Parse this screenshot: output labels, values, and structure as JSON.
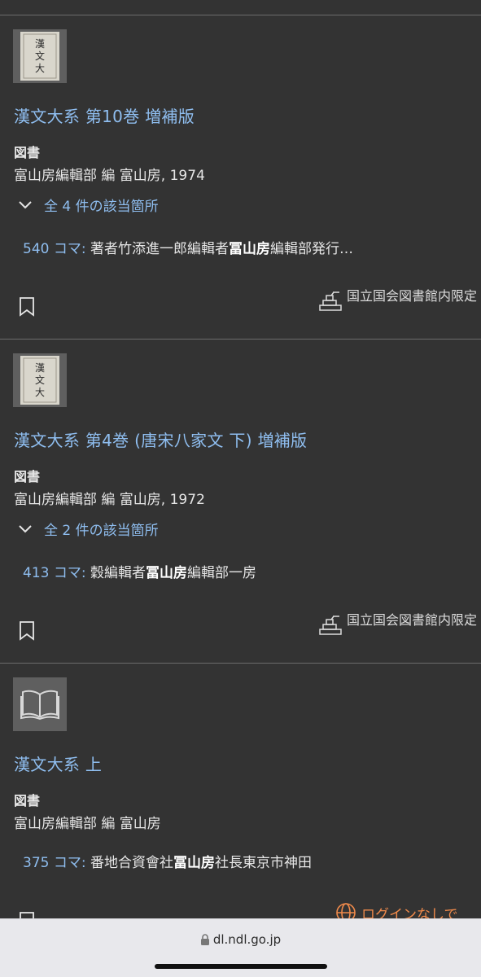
{
  "results": [
    {
      "title": "漢文大系 第10巻 増補版",
      "type": "図書",
      "publisher": "富山房編輯部 編 富山房, 1974",
      "hits_label": "全 4 件の該当箇所",
      "snippet_frame": "540 コマ:",
      "snippet_pre": " 著者竹添進一郎編輯者",
      "snippet_match": "冨山房",
      "snippet_post": "編輯部発行…",
      "access_label": "国立国会図書館内限定",
      "thumb": "book-cover"
    },
    {
      "title": "漢文大系 第4巻 (唐宋八家文 下) 増補版",
      "type": "図書",
      "publisher": "富山房編輯部 編 富山房, 1972",
      "hits_label": "全 2 件の該当箇所",
      "snippet_frame": "413 コマ:",
      "snippet_pre": " 穀編輯者",
      "snippet_match": "冨山房",
      "snippet_post": "編輯部一房",
      "access_label": "国立国会図書館内限定",
      "thumb": "book-cover"
    },
    {
      "title": "漢文大系 上",
      "type": "図書",
      "publisher": "富山房編輯部 編 富山房",
      "snippet_frame": "375 コマ:",
      "snippet_pre": " 番地合資會社",
      "snippet_match": "冨山房",
      "snippet_post": "社長東京市神田",
      "access_label": "ログインなしで",
      "thumb": "open-book-icon"
    }
  ],
  "browser": {
    "url": "dl.ndl.go.jp"
  },
  "colors": {
    "background": "#333333",
    "link": "#8fbef0",
    "access_orange": "#f08a4b"
  }
}
